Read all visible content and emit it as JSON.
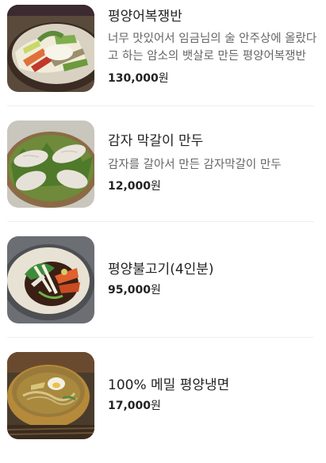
{
  "menu": {
    "items": [
      {
        "name": "평양어복쟁반",
        "description": "너무 맛있어서 임금님의 술 안주상에 올랐다고 하는 암소의 뱃살로 만든 평양어복쟁반",
        "price_amount": "130,000",
        "price_unit": "원",
        "image": "eobok-jaengban-hotpot-photo"
      },
      {
        "name": "감자 막갈이 만두",
        "description": "감자를 갈아서 만든 감자막갈이 만두",
        "price_amount": "12,000",
        "price_unit": "원",
        "image": "potato-dumplings-photo"
      },
      {
        "name": "평양불고기(4인분)",
        "description": "",
        "price_amount": "95,000",
        "price_unit": "원",
        "image": "bulgogi-platter-photo"
      },
      {
        "name": "100% 메밀 평양냉면",
        "description": "",
        "price_amount": "17,000",
        "price_unit": "원",
        "image": "pyongyang-naengmyeon-photo"
      }
    ]
  }
}
